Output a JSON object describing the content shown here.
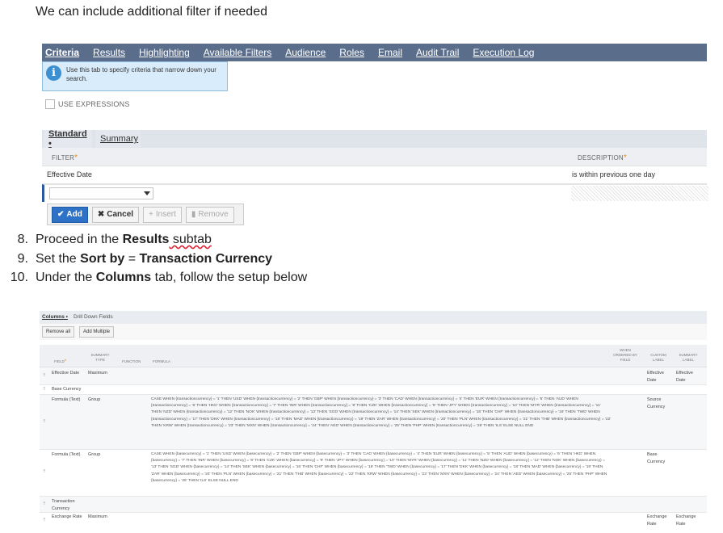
{
  "intro_text": "We can include additional filter if needed",
  "shot1": {
    "tabs": [
      "Criteria",
      "Results",
      "Highlighting",
      "Available Filters",
      "Audience",
      "Roles",
      "Email",
      "Audit Trail",
      "Execution Log"
    ],
    "info_text": "Use this tab to specify criteria that narrow down your search.",
    "use_expressions_label": "USE EXPRESSIONS",
    "subtabs": {
      "standard": "Standard •",
      "summary": "Summary"
    },
    "columns": {
      "filter": "FILTER",
      "description": "DESCRIPTION"
    },
    "row": {
      "filter": "Effective Date",
      "description": "is within previous one day"
    },
    "buttons": {
      "add": "Add",
      "cancel": "Cancel",
      "insert": "Insert",
      "remove": "Remove"
    }
  },
  "steps": [
    {
      "num": "8.",
      "pre": "Proceed in the ",
      "bold": "Results",
      "post": " subtab"
    },
    {
      "num": "9.",
      "pre": "Set the ",
      "bold": "Sort by",
      "mid": " = ",
      "bold2": "Transaction Currency"
    },
    {
      "num": "10.",
      "pre": "Under the ",
      "bold": "Columns",
      "post": " tab, follow the setup below"
    }
  ],
  "shot2": {
    "tabs": {
      "columns": "Columns •",
      "drill": "Drill Down Fields"
    },
    "buttons": {
      "remove_all": "Remove all",
      "add_multiple": "Add Multiple"
    },
    "headers": {
      "field": "FIELD",
      "summary_type": "SUMMARY TYPE",
      "function": "FUNCTION",
      "formula": "FORMULA",
      "when_ordered": "WHEN ORDERED BY FIELD",
      "custom_label": "CUSTOM LABEL",
      "summary_label": "SUMMARY LABEL"
    },
    "rows": [
      {
        "field": "Effective Date",
        "summary": "Maximum",
        "formula": "",
        "custom": "Effective Date",
        "slabel": "Effective Date"
      },
      {
        "field": "Base Currency",
        "summary": "",
        "formula": "",
        "custom": "",
        "slabel": ""
      },
      {
        "field": "Formula (Text)",
        "summary": "Group",
        "formula": "CASE WHEN {transactioncurrency} = '1' THEN 'USD' WHEN {transactioncurrency} = '2' THEN 'GBP' WHEN {transactioncurrency} = '3' THEN 'CAD' WHEN {transactioncurrency} = '4' THEN 'EUR' WHEN {transactioncurrency} = '5' THEN 'AUD' WHEN {transactioncurrency} = '6' THEN 'HKD' WHEN {transactioncurrency} = '7' THEN 'INR' WHEN {transactioncurrency} = '8' THEN 'CZK' WHEN {transactioncurrency} = '9' THEN 'JPY' WHEN {transactioncurrency} = '10' THEN 'MYR' WHEN {transactioncurrency} = '11' THEN 'NZD' WHEN {transactioncurrency} = '12' THEN 'NOK' WHEN {transactioncurrency} = '13' THEN 'SGD' WHEN {transactioncurrency} = '14' THEN 'SEK' WHEN {transactioncurrency} = '15' THEN 'CHF' WHEN {transactioncurrency} = '16' THEN 'TWD' WHEN {transactioncurrency} = '17' THEN 'DKK' WHEN {transactioncurrency} = '18' THEN 'MAD' WHEN {transactioncurrency} = '19' THEN 'ZAR' WHEN {transactioncurrency} = '20' THEN 'PLN' WHEN {transactioncurrency} = '21' THEN 'THB' WHEN {transactioncurrency} = '22' THEN 'KRW' WHEN {transactioncurrency} = '23' THEN 'MXN' WHEN {transactioncurrency} = '24' THEN 'AED' WHEN {transactioncurrency} = '25' THEN 'PHP' WHEN {transactioncurrency} = '26' THEN 'ILS' ELSE NULL END",
        "custom": "Source Currency",
        "slabel": ""
      },
      {
        "field": "Formula (Text)",
        "summary": "Group",
        "formula": "CASE WHEN {basecurrency} = '1' THEN 'USD' WHEN {basecurrency} = '2' THEN 'GBP' WHEN {basecurrency} = '3' THEN 'CAD' WHEN {basecurrency} = '4' THEN 'EUR' WHEN {basecurrency} = '5' THEN 'AUD' WHEN {basecurrency} = '6' THEN 'HKD' WHEN {basecurrency} = '7' THEN 'INR' WHEN {basecurrency} = '8' THEN 'CZK' WHEN {basecurrency} = '9' THEN 'JPY' WHEN {basecurrency} = '10' THEN 'MYR' WHEN {basecurrency} = '11' THEN 'NZD' WHEN {basecurrency} = '12' THEN 'NOK' WHEN {basecurrency} = '13' THEN 'SGD' WHEN {basecurrency} = '14' THEN 'SEK' WHEN {basecurrency} = '15' THEN 'CHF' WHEN {basecurrency} = '16' THEN 'TWD' WHEN {basecurrency} = '17' THEN 'DKK' WHEN {basecurrency} = '18' THEN 'MAD' WHEN {basecurrency} = '19' THEN 'ZAR' WHEN {basecurrency} = '20' THEN 'PLN' WHEN {basecurrency} = '21' THEN 'THB' WHEN {basecurrency} = '22' THEN 'KRW' WHEN {basecurrency} = '23' THEN 'MXN' WHEN {basecurrency} = '24' THEN 'AED' WHEN {basecurrency} = '25' THEN 'PHP' WHEN {basecurrency} = '26' THEN 'ILS' ELSE NULL END",
        "custom": "Base Currency",
        "slabel": ""
      },
      {
        "field": "Transaction Currency",
        "summary": "",
        "formula": "",
        "custom": "",
        "slabel": ""
      },
      {
        "field": "Exchange Rate",
        "summary": "Maximum",
        "formula": "",
        "custom": "Exchange Rate",
        "slabel": "Exchange Rate"
      }
    ]
  },
  "colors": {
    "tabbar": "#5a6e8c",
    "primary": "#2d72c6",
    "required": "#e58b17",
    "info_bg": "#d9ecfb"
  }
}
